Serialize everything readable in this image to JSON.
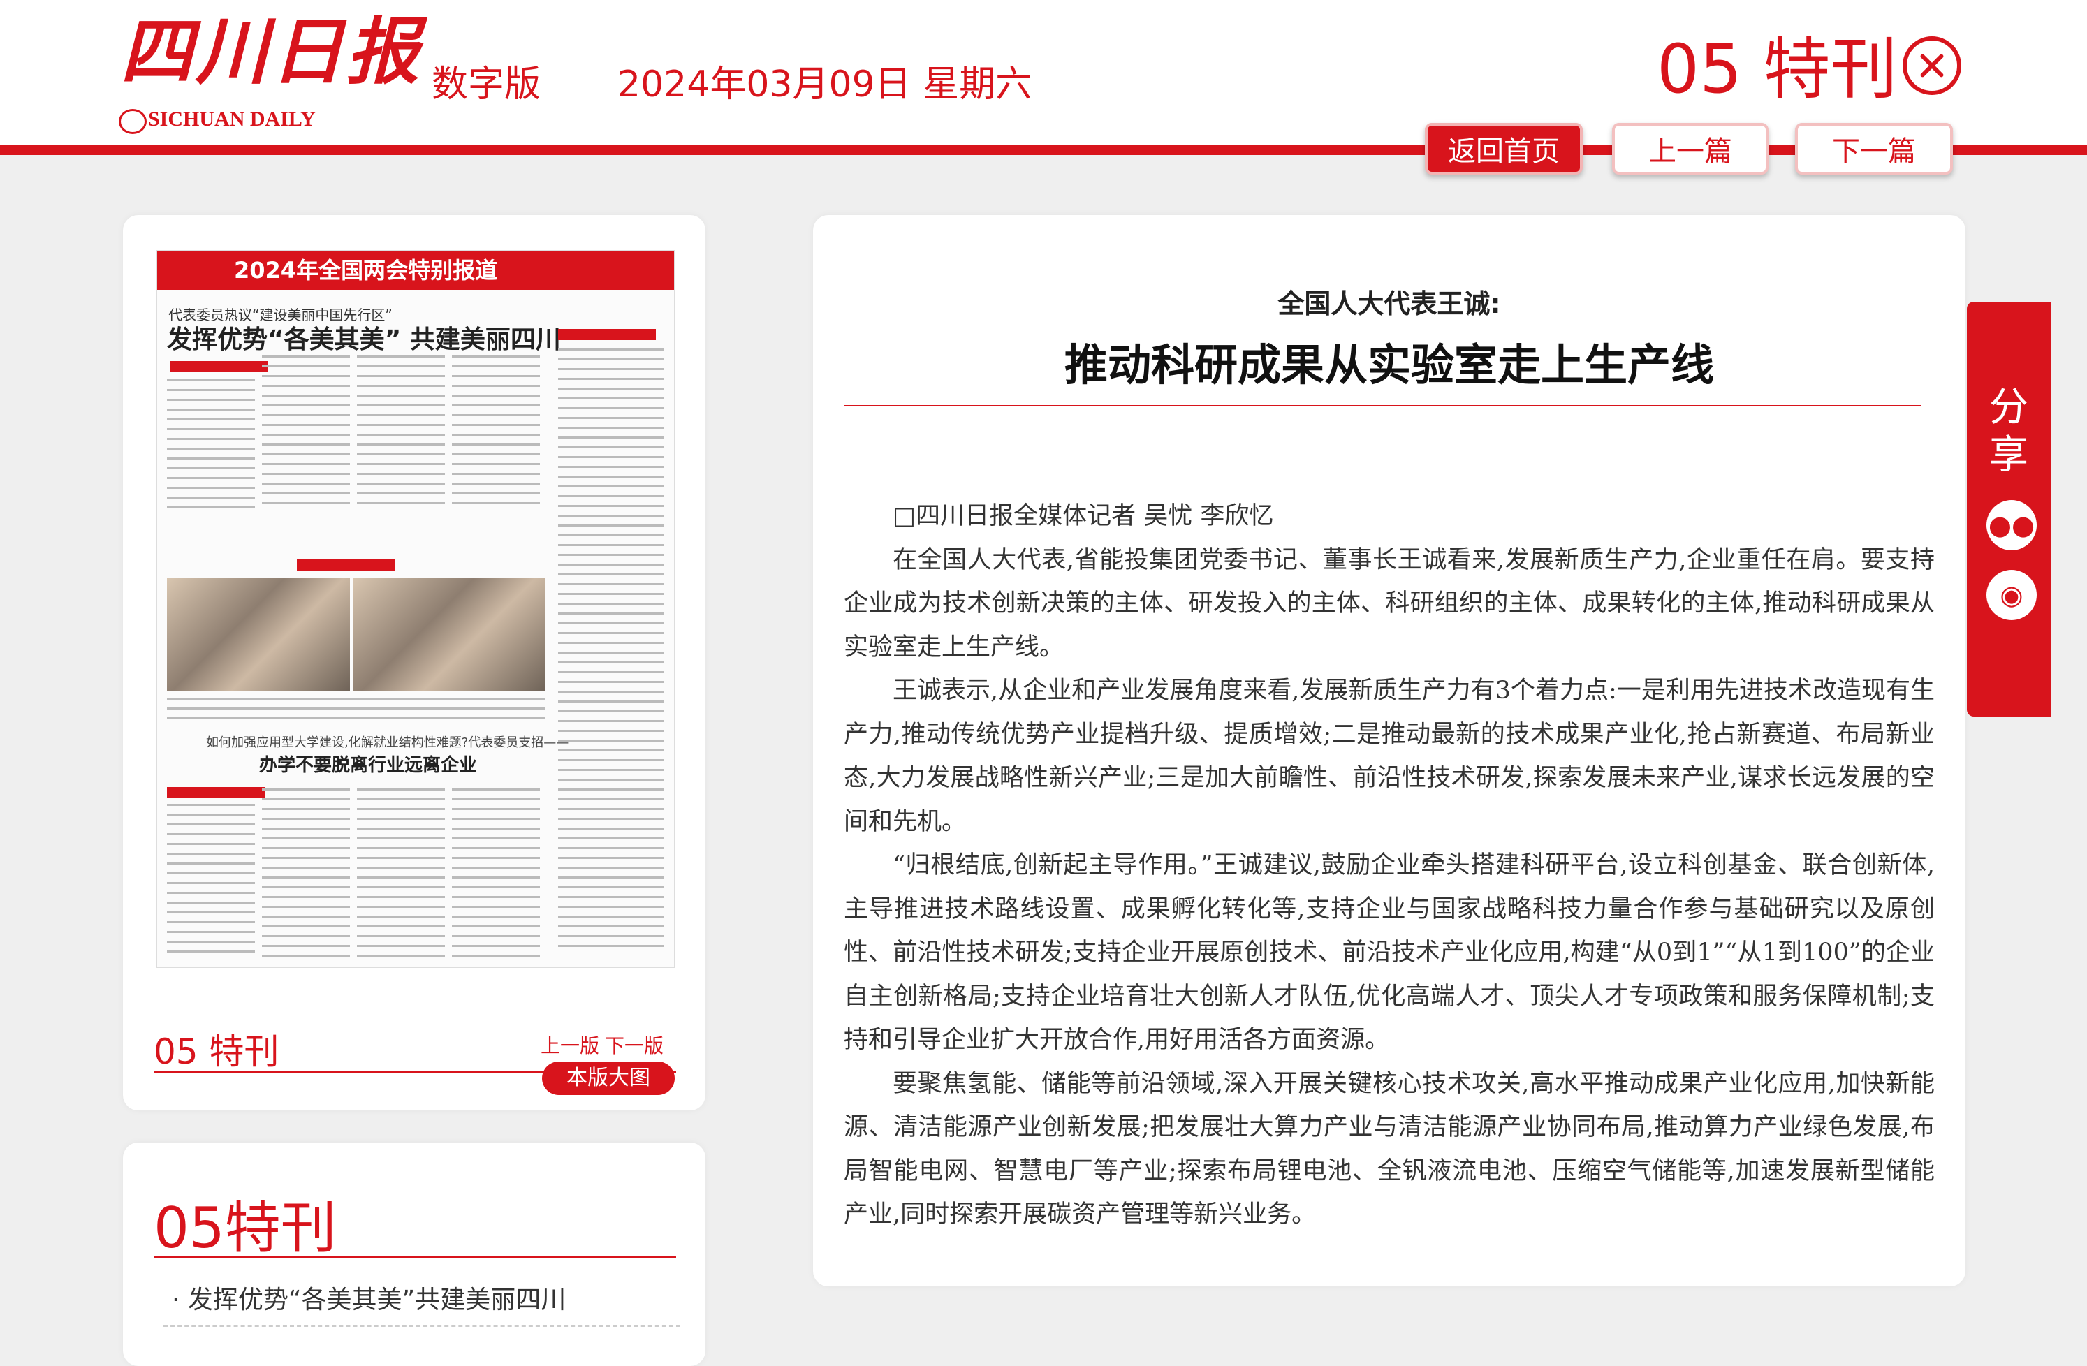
{
  "header": {
    "logo_cn": "四川日报",
    "logo_en": "SICHUAN DAILY",
    "edition_label": "数字版",
    "date": "2024年03月09日 星期六",
    "page_title": "05 特刊",
    "buttons": {
      "home": "返回首页",
      "prev": "上一篇",
      "next": "下一篇"
    }
  },
  "thumbnail": {
    "banner": "2024年全国两会特别报道",
    "subhead": "代表委员热议“建设美丽中国先行区”",
    "headline": "发挥优势“各美其美” 共建美丽四川",
    "lower_question": "如何加强应用型大学建设,化解就业结构性难题?代表委员支招——",
    "lower_headline": "办学不要脱离行业远离企业",
    "page_label": "05 特刊",
    "prev_page": "上一版",
    "next_page": "下一版",
    "full_view": "本版大图"
  },
  "list": {
    "title": "05特刊",
    "items": [
      "· 发挥优势“各美其美”共建美丽四川"
    ]
  },
  "article": {
    "kicker": "全国人大代表王诚:",
    "title": "推动科研成果从实验室走上生产线",
    "byline": "□四川日报全媒体记者 吴忧 李欣忆",
    "paragraphs": [
      "在全国人大代表,省能投集团党委书记、董事长王诚看来,发展新质生产力,企业重任在肩。要支持企业成为技术创新决策的主体、研发投入的主体、科研组织的主体、成果转化的主体,推动科研成果从实验室走上生产线。",
      "王诚表示,从企业和产业发展角度来看,发展新质生产力有3个着力点:一是利用先进技术改造现有生产力,推动传统优势产业提档升级、提质增效;二是推动最新的技术成果产业化,抢占新赛道、布局新业态,大力发展战略性新兴产业;三是加大前瞻性、前沿性技术研发,探索发展未来产业,谋求长远发展的空间和先机。",
      "“归根结底,创新起主导作用。”王诚建议,鼓励企业牵头搭建科研平台,设立科创基金、联合创新体,主导推进技术路线设置、成果孵化转化等,支持企业与国家战略科技力量合作参与基础研究以及原创性、前沿性技术研发;支持企业开展原创技术、前沿技术产业化应用,构建“从0到1”“从1到100”的企业自主创新格局;支持企业培育壮大创新人才队伍,优化高端人才、顶尖人才专项政策和服务保障机制;支持和引导企业扩大开放合作,用好用活各方面资源。",
      "要聚焦氢能、储能等前沿领域,深入开展关键核心技术攻关,高水平推动成果产业化应用,加快新能源、清洁能源产业创新发展;把发展壮大算力产业与清洁能源产业协同布局,推动算力产业绿色发展,布局智能电网、智慧电厂等产业;探索布局锂电池、全钒液流电池、压缩空气储能等,加速发展新型储能产业,同时探索开展碳资产管理等新兴业务。"
    ]
  },
  "share": {
    "label": "分享",
    "icons": [
      "wechat-icon",
      "weibo-icon"
    ]
  },
  "colors": {
    "brand_red": "#d8141c",
    "background": "#efefef"
  }
}
